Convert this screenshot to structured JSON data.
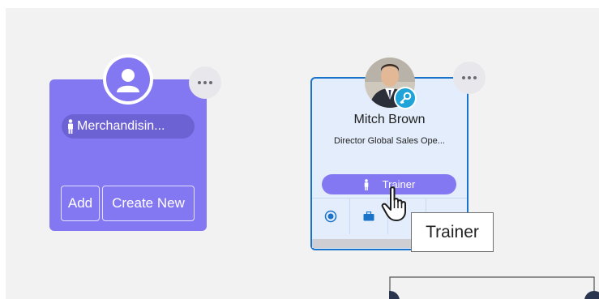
{
  "vacant_card": {
    "role_label": "Merchandisin...",
    "add_label": "Add",
    "create_new_label": "Create New"
  },
  "employee_card": {
    "name": "Mitch Brown",
    "title": "Director Global Sales Ope...",
    "role_label": "Trainer"
  },
  "tooltip": {
    "text": "Trainer"
  },
  "colors": {
    "vacant_card": "#8478f2",
    "vacant_pill": "#6d62d4",
    "employee_card_bg": "#e3edfb",
    "employee_card_border": "#1a73c9",
    "key_badge": "#1fa3d9"
  },
  "icons": {
    "vacant_avatar": "person-icon",
    "role": "person-standing-icon",
    "key_badge": "key-icon",
    "more": "more-dots-icon",
    "tab_1": "radio-target-icon",
    "tab_2": "briefcase-icon",
    "cursor": "hand-pointer-icon"
  }
}
